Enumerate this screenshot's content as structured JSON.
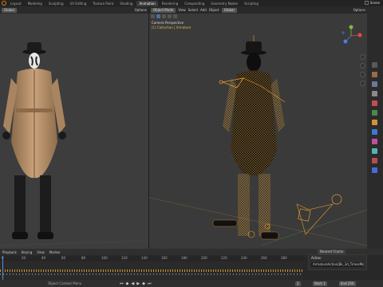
{
  "topbar": {
    "tabs": [
      "Layout",
      "Modeling",
      "Sculpting",
      "UV Editing",
      "Texture Paint",
      "Shading",
      "Animation",
      "Rendering",
      "Compositing",
      "Geometry Nodes",
      "Scripting"
    ],
    "active_tab": "Animation",
    "scene_label": "Scene"
  },
  "left_viewport": {
    "mode": "Global",
    "options_label": "Options"
  },
  "right_viewport": {
    "mode_label": "Object Mode",
    "menus": [
      "View",
      "Select",
      "Add",
      "Object"
    ],
    "orientation": "Global",
    "options_label": "Options",
    "info_line1": "Camera Perspective",
    "info_line2": "(1) Collection | Armature"
  },
  "timeline": {
    "menus": [
      "Playback",
      "Keying",
      "View",
      "Marker"
    ],
    "ruler": [
      "0",
      "20",
      "40",
      "60",
      "80",
      "100",
      "120",
      "140",
      "160",
      "180",
      "200",
      "220",
      "240",
      "260",
      "280"
    ],
    "current_frame": "1",
    "start_label": "Start",
    "start_value": "1",
    "end_label": "End",
    "end_value": "250",
    "status": "Object Context Menu",
    "interpolation": "Nearest Frame"
  },
  "action_panel": {
    "title": "Action",
    "value": "ArmatureAction|Bk_3d_TimesMotion"
  },
  "colors": {
    "accent": "#e87d0d",
    "selected_wire": "#e39a2a",
    "playhead": "#4a90e2"
  }
}
